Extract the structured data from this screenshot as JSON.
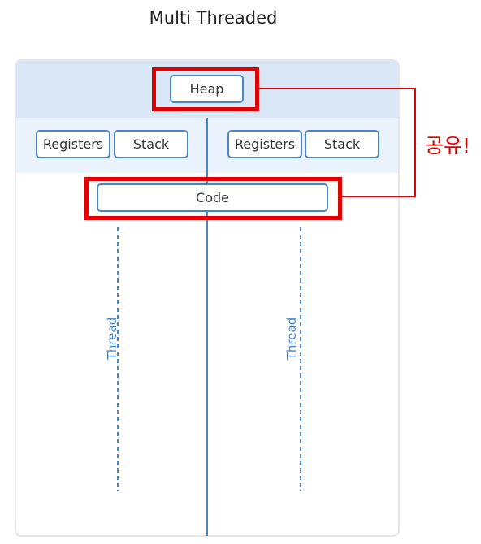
{
  "title": "Multi Threaded",
  "heap": "Heap",
  "code": "Code",
  "left_thread": {
    "registers": "Registers",
    "stack": "Stack",
    "label": "Thread"
  },
  "right_thread": {
    "registers": "Registers",
    "stack": "Stack",
    "label": "Thread"
  },
  "annotation": "공유!",
  "colors": {
    "highlight": "#e00000",
    "accent": "#4a86c5",
    "heap_band": "#d9e7f6",
    "register_band": "#eaf2fb"
  }
}
